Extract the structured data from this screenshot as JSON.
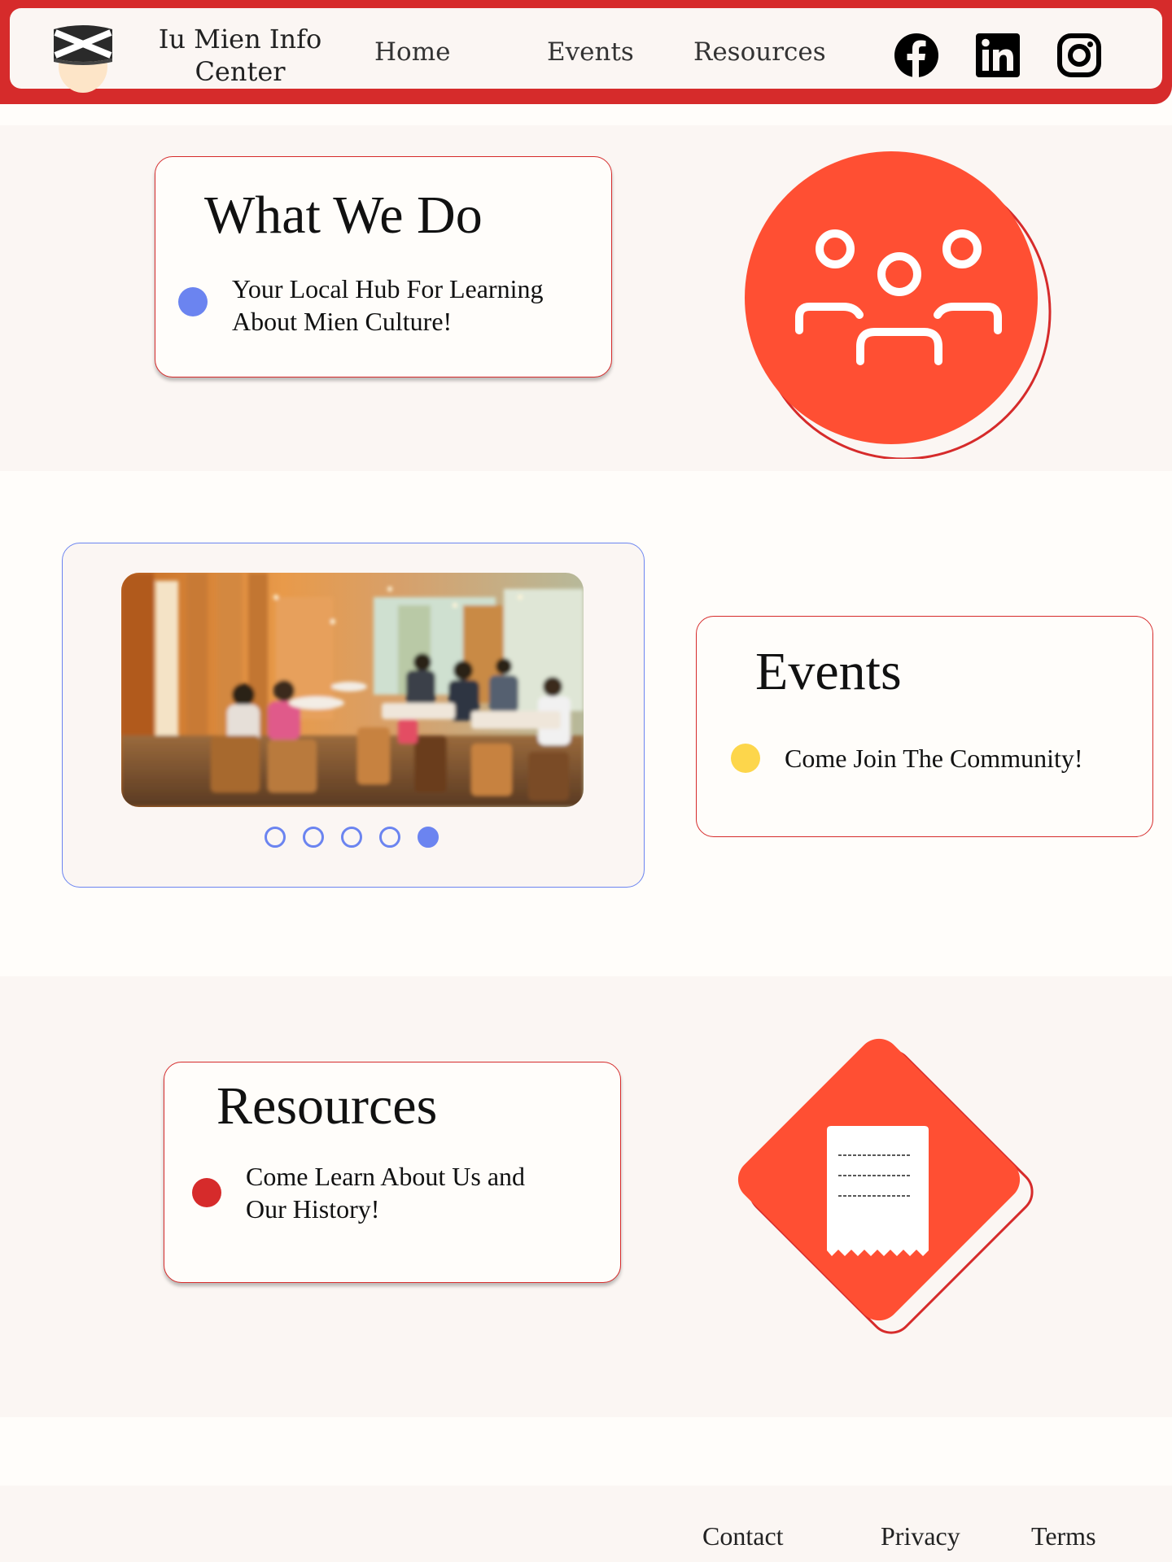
{
  "header": {
    "brand": "Iu Mien Info Center",
    "nav": [
      {
        "label": "Home"
      },
      {
        "label": "Events"
      },
      {
        "label": "Resources"
      }
    ],
    "social": [
      {
        "icon": "facebook-icon"
      },
      {
        "icon": "linkedin-icon"
      },
      {
        "icon": "instagram-icon"
      }
    ]
  },
  "what_we_do": {
    "title": "What We Do",
    "text": "Your Local Hub For Learning About Mien Culture!",
    "dot_color": "#6b84f0",
    "icon": "people-group-icon"
  },
  "events": {
    "title": "Events",
    "text": "Come Join The Community!",
    "dot_color": "#fdd64b",
    "carousel": {
      "slide_count": 5,
      "active_index": 4
    }
  },
  "resources": {
    "title": "Resources",
    "text": "Come Learn About Us and Our History!",
    "dot_color": "#d62b2b",
    "icon": "receipt-document-icon"
  },
  "footer": {
    "links": [
      {
        "label": "Contact"
      },
      {
        "label": "Privacy"
      },
      {
        "label": "Terms"
      }
    ]
  },
  "colors": {
    "brand_red": "#d62b2b",
    "accent_orange": "#ff4f33",
    "accent_blue": "#6b84f0",
    "accent_yellow": "#fdd64b",
    "background": "#fffdfa",
    "band": "#fbf6f3"
  }
}
